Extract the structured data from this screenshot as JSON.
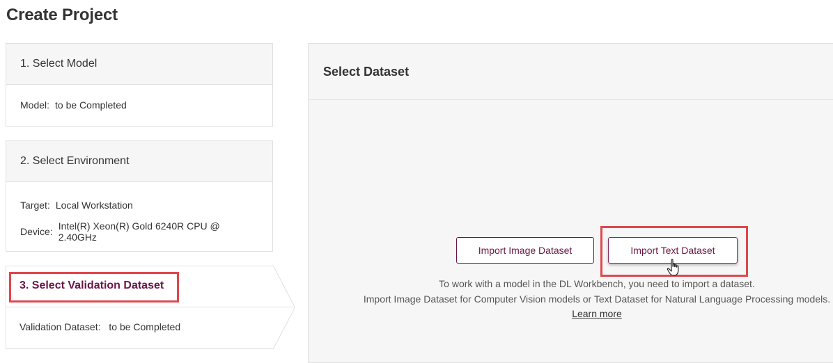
{
  "page": {
    "title": "Create Project"
  },
  "steps": {
    "model": {
      "title": "1. Select Model",
      "model_label": "Model:",
      "model_value": "to be Completed"
    },
    "environment": {
      "title": "2. Select Environment",
      "target_label": "Target:",
      "target_value": "Local Workstation",
      "device_label": "Device:",
      "device_value": "Intel(R) Xeon(R) Gold 6240R CPU @ 2.40GHz"
    },
    "dataset": {
      "title": "3. Select Validation Dataset",
      "dataset_label": "Validation Dataset:",
      "dataset_value": "to be Completed"
    }
  },
  "main": {
    "title": "Select Dataset",
    "import_image_label": "Import Image Dataset",
    "import_text_label": "Import Text Dataset",
    "info_line1": "To work with a model in the DL Workbench, you need to import a dataset.",
    "info_line2": "Import Image Dataset for Computer Vision models or Text Dataset for Natural Language Processing models.",
    "learn_more": "Learn more"
  },
  "colors": {
    "accent": "#6b1645",
    "highlight": "#e0474c",
    "panel_bg": "#f6f6f6",
    "border": "#e0e0e0"
  },
  "icons": {
    "cursor": "hand-pointer-icon"
  }
}
